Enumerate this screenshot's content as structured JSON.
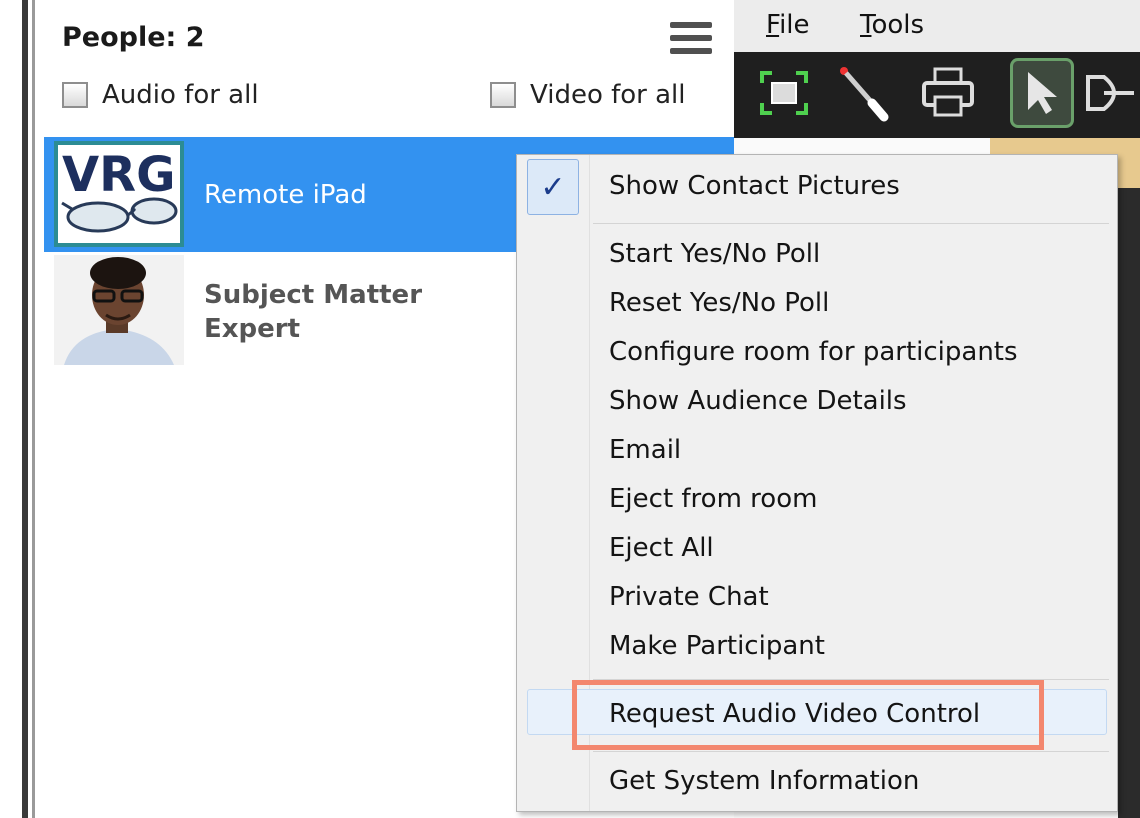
{
  "people_panel": {
    "title": "People: 2",
    "audio_for_all": "Audio for all",
    "video_for_all": "Video for all",
    "participants": [
      {
        "name": "Remote iPad",
        "avatar": "VRG",
        "selected": true
      },
      {
        "name_line1": "Subject Matter",
        "name_line2": "Expert",
        "avatar": "person-photo",
        "selected": false
      }
    ]
  },
  "menubar": {
    "file": "File",
    "tools": "Tools"
  },
  "toolbar": {
    "icons": [
      "screenshot-icon",
      "laser-pointer-icon",
      "printer-icon",
      "pointer-arrow-icon",
      "highlighter-icon"
    ],
    "active": "pointer-arrow-icon"
  },
  "context_menu": {
    "items": [
      "Show Contact Pictures",
      "Start Yes/No Poll",
      "Reset Yes/No Poll",
      "Configure room for participants",
      "Show Audience Details",
      "Email",
      "Eject from room",
      "Eject All",
      "Private Chat",
      "Make Participant",
      "Request Audio Video Control",
      "Get System Information"
    ],
    "checked_item": "Show Contact Pictures",
    "highlighted_item": "Request Audio Video Control",
    "highlight_color": "#f3876e"
  },
  "colors": {
    "selection": "#3392f0",
    "accent_check": "#1c3d8c"
  }
}
